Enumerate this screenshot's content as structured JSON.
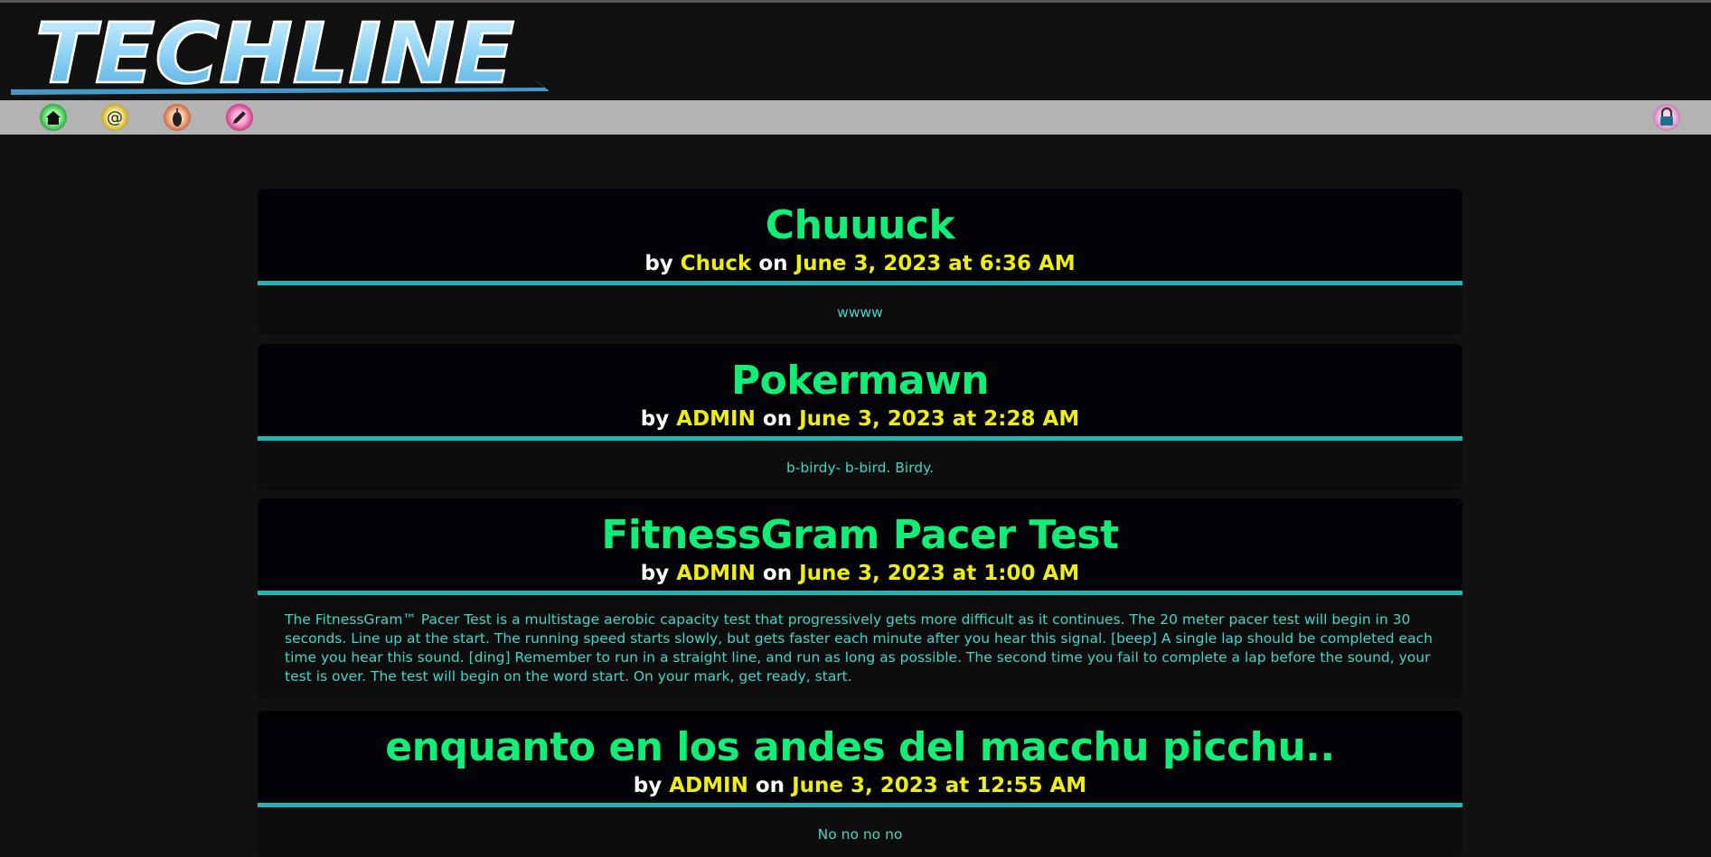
{
  "site": {
    "logo_text": "TECHLINE"
  },
  "nav": {
    "items": [
      {
        "icon": "home-icon"
      },
      {
        "icon": "at-mail-icon"
      },
      {
        "icon": "bomb-icon"
      },
      {
        "icon": "pencil-icon"
      }
    ],
    "right_icon": "lock-icon"
  },
  "colors": {
    "title": "#11ee77",
    "meta_highlight": "#eeee11",
    "body_text": "#3fd6c6",
    "divider": "#22b3b3",
    "nav_bg": "#b3b3b3"
  },
  "posts": [
    {
      "title": "Chuuuck",
      "by_label": "by",
      "author": "Chuck",
      "on_label": "on",
      "date": "June 3, 2023 at 6:36 AM",
      "body": "wwww"
    },
    {
      "title": "Pokermawn",
      "by_label": "by",
      "author": "ADMIN",
      "on_label": "on",
      "date": "June 3, 2023 at 2:28 AM",
      "body": "b-birdy- b-bird. Birdy."
    },
    {
      "title": "FitnessGram Pacer Test",
      "by_label": "by",
      "author": "ADMIN",
      "on_label": "on",
      "date": "June 3, 2023 at 1:00 AM",
      "body": "The FitnessGram™ Pacer Test is a multistage aerobic capacity test that progressively gets more difficult as it continues. The 20 meter pacer test will begin in 30 seconds. Line up at the start. The running speed starts slowly, but gets faster each minute after you hear this signal. [beep] A single lap should be completed each time you hear this sound. [ding] Remember to run in a straight line, and run as long as possible. The second time you fail to complete a lap before the sound, your test is over. The test will begin on the word start. On your mark, get ready, start."
    },
    {
      "title": "enquanto en los andes del macchu picchu..",
      "by_label": "by",
      "author": "ADMIN",
      "on_label": "on",
      "date": "June 3, 2023 at 12:55 AM",
      "body": "No no no no"
    }
  ]
}
